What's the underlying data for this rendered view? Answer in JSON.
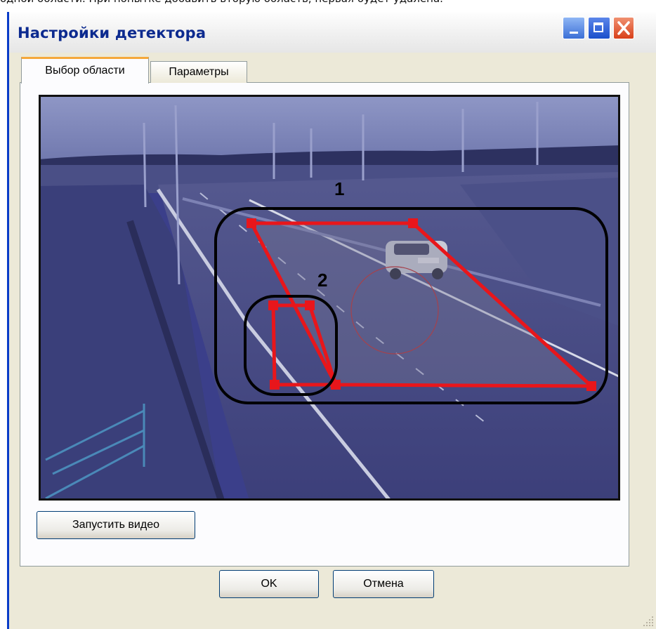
{
  "top_text": "одной области. При попытке добавить вторую область, первая будет удалена.",
  "window": {
    "title": "Настройки детектора",
    "controls": [
      "minimize",
      "maximize",
      "close"
    ]
  },
  "tabs": [
    {
      "label": "Выбор области",
      "active": true
    },
    {
      "label": "Параметры",
      "active": false
    }
  ],
  "video": {
    "annotations": [
      {
        "label": "1"
      },
      {
        "label": "2"
      }
    ],
    "zone_color": "#e8161b",
    "annotation_color": "#000000"
  },
  "buttons": {
    "start_video": "Запустить видео",
    "ok": "OK",
    "cancel": "Отмена"
  },
  "colors": {
    "title_text": "#0c2a8f",
    "dialog_bg": "#ece9d8",
    "active_tab_accent": "#f5a83a",
    "video_tint": "#3b3f8a"
  }
}
